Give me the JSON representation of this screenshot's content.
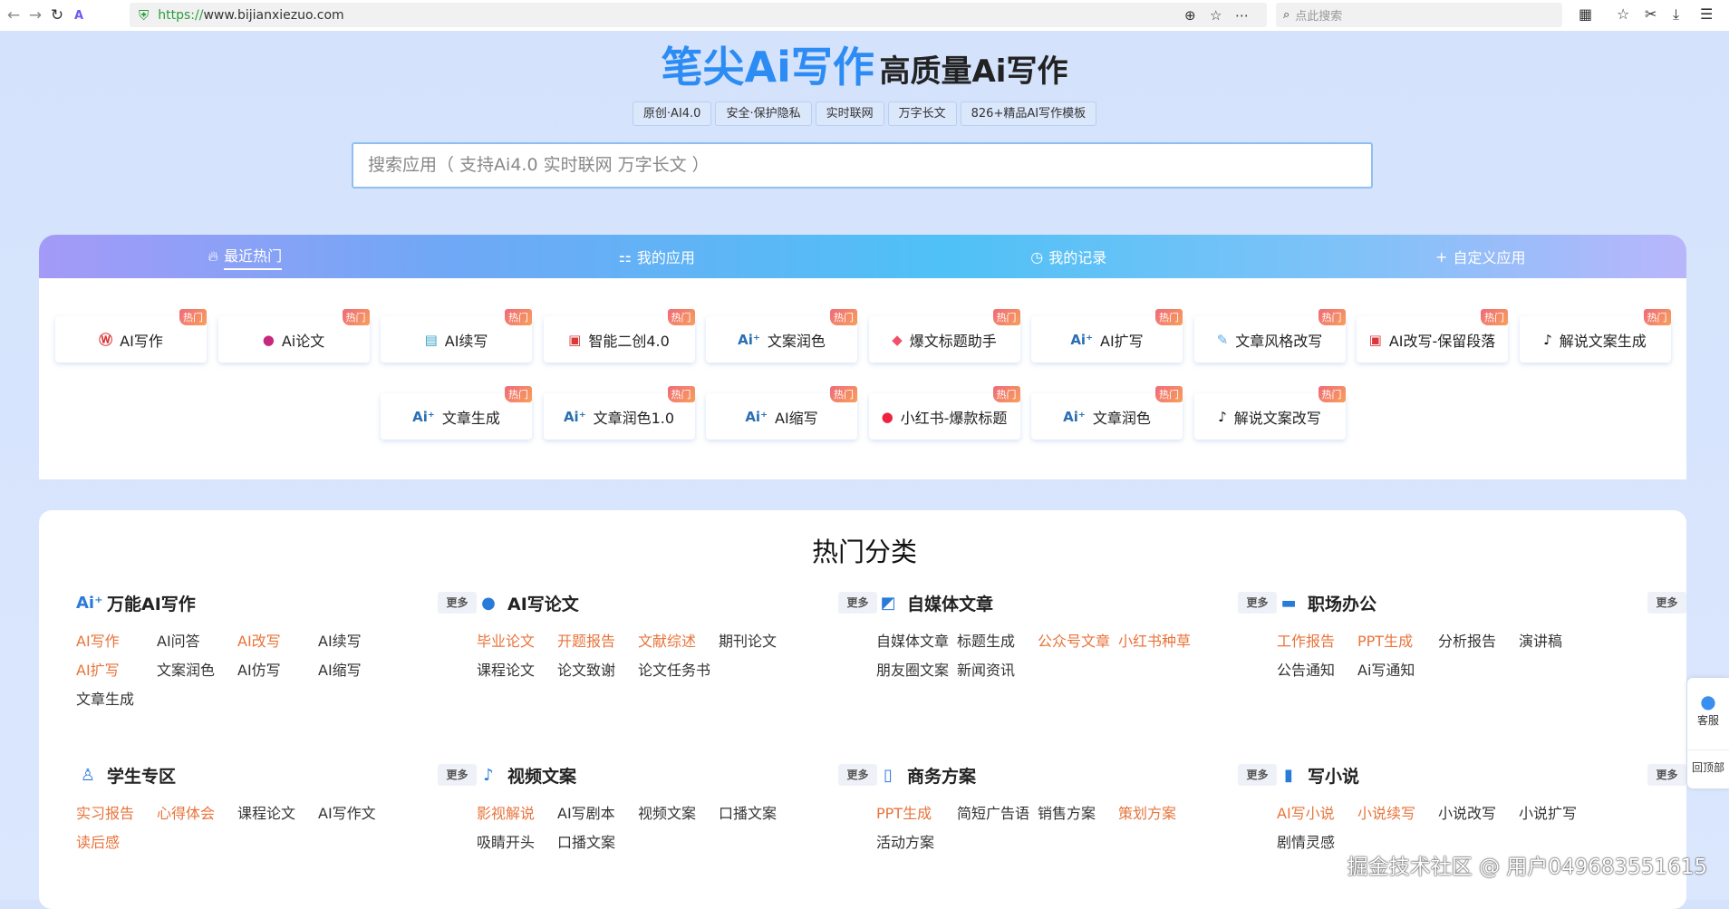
{
  "browser": {
    "url_scheme": "https://",
    "url_rest": "www.bijianxiezuo.com",
    "search_placeholder": "点此搜索"
  },
  "header": {
    "brand": "笔尖Ai写作",
    "subtitle": "高质量Ai写作",
    "tags": [
      "原创·AI4.0",
      "安全·保护隐私",
      "实时联网",
      "万字长文",
      "826+精品AI写作模板"
    ],
    "search_placeholder": "搜索应用（ 支持Ai4.0 实时联网 万字长文 ）"
  },
  "tabs": [
    {
      "label": "最近热门",
      "icon": "flame-icon"
    },
    {
      "label": "我的应用",
      "icon": "grid-icon"
    },
    {
      "label": "我的记录",
      "icon": "clock-icon"
    },
    {
      "label": "自定义应用",
      "icon": "plus-icon"
    }
  ],
  "badge": "热门",
  "apps_row1": [
    {
      "label": "AI写作",
      "icon": "ai-write-icon",
      "color": "#d9383a"
    },
    {
      "label": "Ai论文",
      "icon": "thesis-icon",
      "color": "#c8287c"
    },
    {
      "label": "AI续写",
      "icon": "continue-icon",
      "color": "#3aa0c8"
    },
    {
      "label": "智能二创4.0",
      "icon": "recreate-icon",
      "color": "#d9383a"
    },
    {
      "label": "文案润色",
      "icon": "ai-icon",
      "color": "#2a6fb3"
    },
    {
      "label": "爆文标题助手",
      "icon": "tag-icon",
      "color": "#f0506a"
    },
    {
      "label": "AI扩写",
      "icon": "ai-icon",
      "color": "#2a6fb3"
    },
    {
      "label": "文章风格改写",
      "icon": "edit-icon",
      "color": "#5aa8e8"
    },
    {
      "label": "AI改写-保留段落",
      "icon": "recreate-icon",
      "color": "#d9383a"
    },
    {
      "label": "解说文案生成",
      "icon": "tiktok-icon",
      "color": "#111"
    }
  ],
  "apps_row2": [
    {
      "label": "文章生成",
      "icon": "ai-icon",
      "color": "#2a6fb3"
    },
    {
      "label": "文章润色1.0",
      "icon": "ai-icon",
      "color": "#2a6fb3"
    },
    {
      "label": "AI缩写",
      "icon": "ai-icon",
      "color": "#2a6fb3"
    },
    {
      "label": "小红书-爆款标题",
      "icon": "xiaohongshu-icon",
      "color": "#f02040"
    },
    {
      "label": "文章润色",
      "icon": "ai-icon",
      "color": "#2a6fb3"
    },
    {
      "label": "解说文案改写",
      "icon": "tiktok-icon",
      "color": "#111"
    }
  ],
  "section_title": "热门分类",
  "more_label": "更多",
  "accent_color": "#e8743b",
  "categories": [
    {
      "title": "万能AI写作",
      "icon": "ai-icon",
      "links": [
        {
          "t": "AI写作",
          "hot": true
        },
        {
          "t": "AI问答"
        },
        {
          "t": "AI改写",
          "hot": true
        },
        {
          "t": "AI续写"
        },
        {
          "t": "AI扩写",
          "hot": true
        },
        {
          "t": "文案润色"
        },
        {
          "t": "AI仿写"
        },
        {
          "t": "AI缩写"
        },
        {
          "t": "文章生成"
        }
      ]
    },
    {
      "title": "AI写论文",
      "icon": "thesis-icon",
      "links": [
        {
          "t": "毕业论文",
          "hot": true
        },
        {
          "t": "开题报告",
          "hot": true
        },
        {
          "t": "文献综述",
          "hot": true
        },
        {
          "t": "期刊论文"
        },
        {
          "t": "课程论文"
        },
        {
          "t": "论文致谢"
        },
        {
          "t": "论文任务书"
        }
      ]
    },
    {
      "title": "自媒体文章",
      "icon": "media-icon",
      "links": [
        {
          "t": "自媒体文章"
        },
        {
          "t": "标题生成"
        },
        {
          "t": "公众号文章",
          "hot": true
        },
        {
          "t": "小红书种草",
          "hot": true
        },
        {
          "t": "朋友圈文案"
        },
        {
          "t": "新闻资讯"
        }
      ]
    },
    {
      "title": "职场办公",
      "icon": "briefcase-icon",
      "links": [
        {
          "t": "工作报告",
          "hot": true
        },
        {
          "t": "PPT生成",
          "hot": true
        },
        {
          "t": "分析报告"
        },
        {
          "t": "演讲稿"
        },
        {
          "t": "公告通知"
        },
        {
          "t": "Ai写通知"
        }
      ]
    },
    {
      "title": "学生专区",
      "icon": "student-icon",
      "links": [
        {
          "t": "实习报告",
          "hot": true
        },
        {
          "t": "心得体会",
          "hot": true
        },
        {
          "t": "课程论文"
        },
        {
          "t": "AI写作文"
        },
        {
          "t": "读后感",
          "hot": true
        }
      ]
    },
    {
      "title": "视频文案",
      "icon": "tiktok-icon",
      "links": [
        {
          "t": "影视解说",
          "hot": true
        },
        {
          "t": "AI写剧本"
        },
        {
          "t": "视频文案"
        },
        {
          "t": "口播文案"
        },
        {
          "t": "吸睛开头"
        },
        {
          "t": "口播文案"
        }
      ]
    },
    {
      "title": "商务方案",
      "icon": "business-icon",
      "links": [
        {
          "t": "PPT生成",
          "hot": true
        },
        {
          "t": "简短广告语"
        },
        {
          "t": "销售方案"
        },
        {
          "t": "策划方案",
          "hot": true
        },
        {
          "t": "活动方案"
        }
      ]
    },
    {
      "title": "写小说",
      "icon": "book-icon",
      "links": [
        {
          "t": "AI写小说",
          "hot": true
        },
        {
          "t": "小说续写",
          "hot": true
        },
        {
          "t": "小说改写"
        },
        {
          "t": "小说扩写"
        },
        {
          "t": "剧情灵感"
        }
      ]
    }
  ],
  "float": {
    "service": "客服",
    "top": "回顶部"
  },
  "watermark": "掘金技术社区 @ 用户049683551615"
}
